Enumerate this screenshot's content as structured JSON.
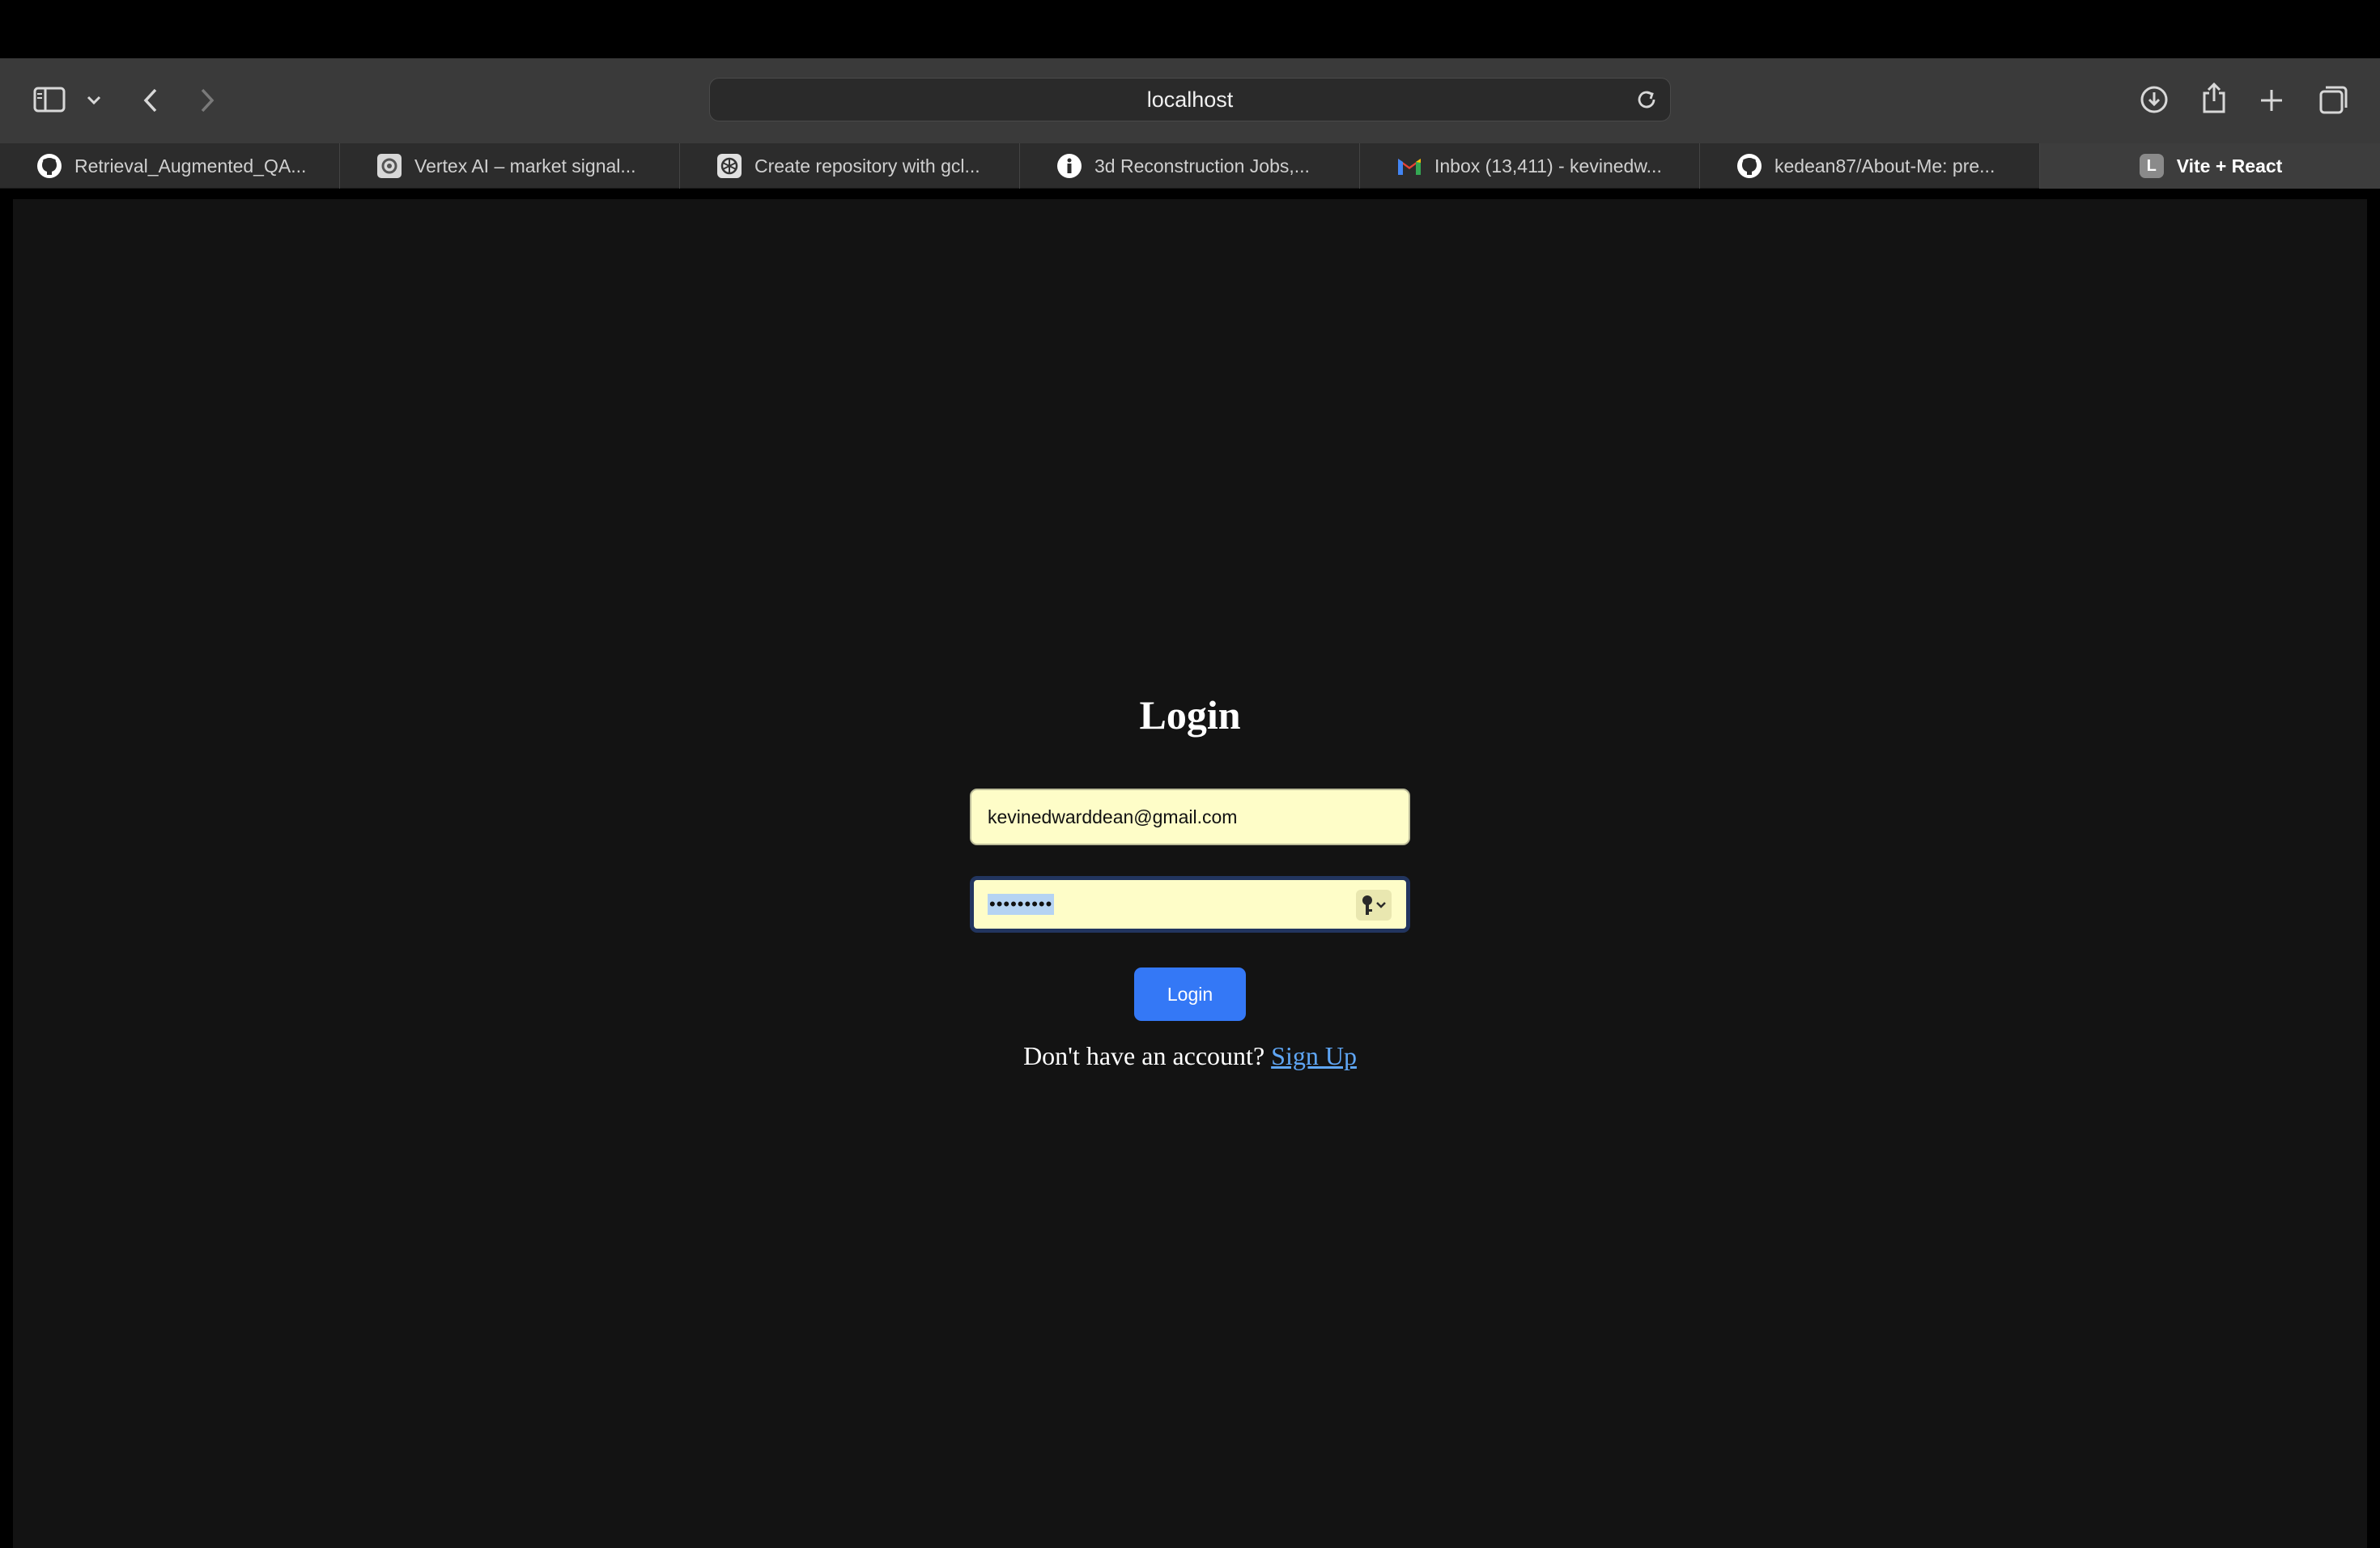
{
  "browser": {
    "address": "localhost",
    "tabs": [
      {
        "label": "Retrieval_Augmented_QA...",
        "icon": "github-icon"
      },
      {
        "label": "Vertex AI – market signal...",
        "icon": "vertex-ai-icon"
      },
      {
        "label": "Create repository with gcl...",
        "icon": "openai-icon"
      },
      {
        "label": "3d Reconstruction Jobs,...",
        "icon": "info-icon"
      },
      {
        "label": "Inbox (13,411) - kevinedw...",
        "icon": "gmail-icon"
      },
      {
        "label": "kedean87/About-Me: pre...",
        "icon": "github-icon"
      },
      {
        "label": "Vite + React",
        "icon": "letter-l-icon",
        "favicon_letter": "L",
        "active": true
      }
    ]
  },
  "login": {
    "title": "Login",
    "email_value": "kevinedwarddean@gmail.com",
    "password_masked": "•••••••••",
    "button_label": "Login",
    "signup_prompt": "Don't have an account?",
    "signup_link": "Sign Up"
  },
  "colors": {
    "page_bg": "#131313",
    "autofill_bg": "#fefdc8",
    "button_blue": "#3478f6",
    "link_blue": "#5fa6f5"
  }
}
